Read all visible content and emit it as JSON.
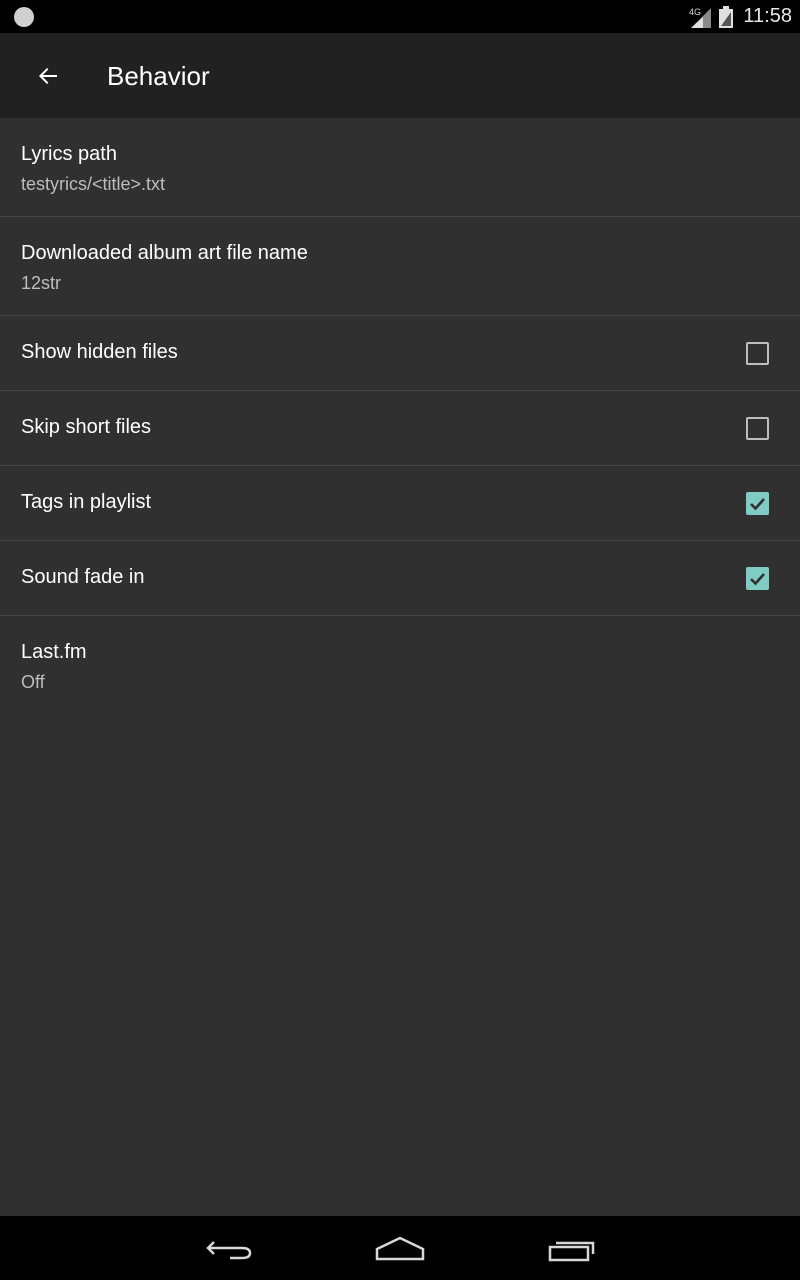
{
  "status_bar": {
    "time": "11:58",
    "network": "4G",
    "icons": [
      "notification-dot-icon",
      "signal-icon",
      "battery-icon"
    ]
  },
  "app_bar": {
    "title": "Behavior",
    "back_icon": "arrow-back-icon"
  },
  "preferences": [
    {
      "title": "Lyrics path",
      "summary": "testyrics/<title>.txt"
    },
    {
      "title": "Downloaded album art file name",
      "summary": "12str"
    },
    {
      "title": "Show hidden files",
      "checked": false
    },
    {
      "title": "Skip short files",
      "checked": false
    },
    {
      "title": "Tags in playlist",
      "checked": true
    },
    {
      "title": "Sound fade in",
      "checked": true
    },
    {
      "title": "Last.fm",
      "summary": "Off"
    }
  ],
  "nav_bar": {
    "buttons": [
      "back-icon",
      "home-icon",
      "recent-apps-icon"
    ]
  },
  "colors": {
    "background": "#303030",
    "app_bar": "#212121",
    "accent": "#80cbc4",
    "divider": "#444444"
  }
}
